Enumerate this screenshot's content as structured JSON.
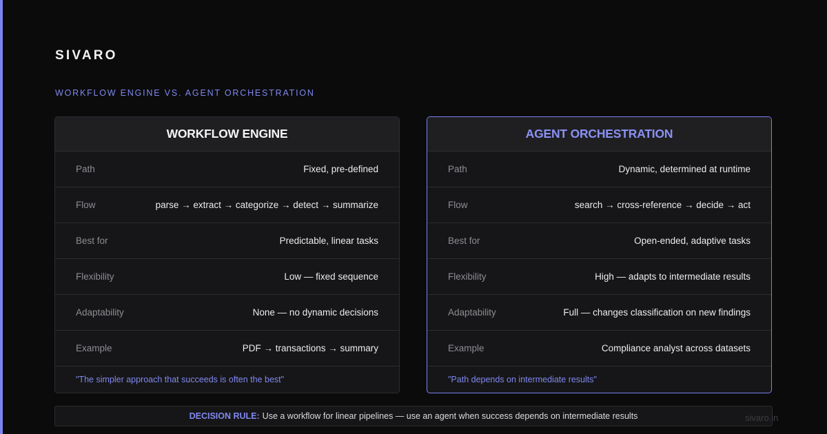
{
  "brand": "SIVARO",
  "subtitle": "WORKFLOW ENGINE VS. AGENT ORCHESTRATION",
  "colors": {
    "accent": "#7b83f0",
    "background": "#0b0b0c",
    "card": "#161618"
  },
  "left": {
    "title": "WORKFLOW ENGINE",
    "rows": [
      {
        "key": "Path",
        "value": "Fixed, pre-defined"
      },
      {
        "key": "Flow",
        "value": "parse → extract → categorize → detect → summarize"
      },
      {
        "key": "Best for",
        "value": "Predictable, linear tasks"
      },
      {
        "key": "Flexibility",
        "value": "Low — fixed sequence"
      },
      {
        "key": "Adaptability",
        "value": "None — no dynamic decisions"
      },
      {
        "key": "Example",
        "value": "PDF → transactions → summary"
      }
    ],
    "quote": "\"The simpler approach that succeeds is often the best\""
  },
  "right": {
    "title": "AGENT ORCHESTRATION",
    "rows": [
      {
        "key": "Path",
        "value": "Dynamic, determined at runtime"
      },
      {
        "key": "Flow",
        "value": "search → cross-reference → decide → act"
      },
      {
        "key": "Best for",
        "value": "Open-ended, adaptive tasks"
      },
      {
        "key": "Flexibility",
        "value": "High — adapts to intermediate results"
      },
      {
        "key": "Adaptability",
        "value": "Full — changes classification on new findings"
      },
      {
        "key": "Example",
        "value": "Compliance analyst across datasets"
      }
    ],
    "quote": "\"Path depends on intermediate results\""
  },
  "decision_rule": {
    "label": "DECISION RULE:",
    "text": "Use a workflow for linear pipelines — use an agent when success depends on intermediate results"
  },
  "footer_url": "sivaro.in"
}
